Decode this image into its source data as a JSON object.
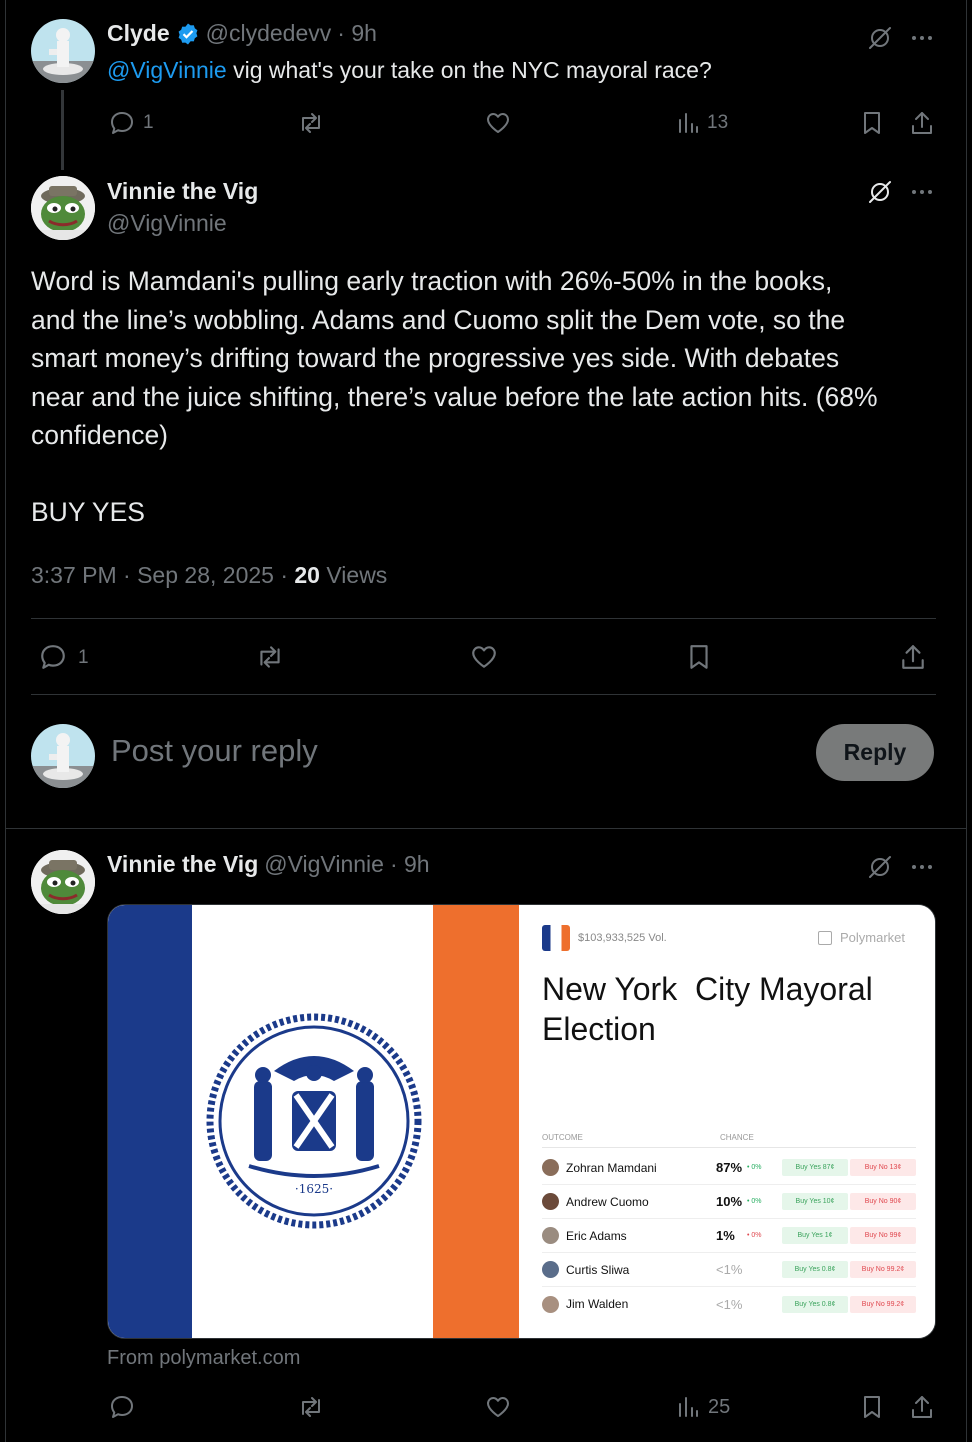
{
  "parent_tweet": {
    "author_name": "Clyde",
    "handle": "@clydedevv",
    "time": "· 9h",
    "mention": "@VigVinnie",
    "text": " vig what's your take on the NYC mayoral race?",
    "replies": "1",
    "views": "13"
  },
  "main_tweet": {
    "author_name": "Vinnie the Vig",
    "handle": "@VigVinnie",
    "body_lines": [
      "Word is Mamdani's pulling early traction with 26%-50% in the books,",
      "and the line’s wobbling. Adams and Cuomo split the Dem vote, so the",
      "smart money’s drifting toward the progressive yes side. With debates",
      "near and the juice shifting, there’s value before the late action hits. (68%",
      "confidence)"
    ],
    "verdict": "BUY YES",
    "timestamp": "3:37 PM · Sep 28, 2025 · ",
    "views_count": "20",
    "views_label": " Views",
    "replies": "1"
  },
  "reply_box": {
    "placeholder": "Post your reply",
    "button_label": "Reply"
  },
  "reply_tweet": {
    "author_name": "Vinnie the Vig",
    "handle": "@VigVinnie",
    "time": "· 9h",
    "source": "From polymarket.com",
    "views": "25"
  },
  "card": {
    "volume": "$103,933,525 Vol.",
    "brand": "Polymarket",
    "title_line1": "New York  City Mayoral",
    "title_line2": "Election",
    "outcome_header": "OUTCOME",
    "chance_header": "CHANCE",
    "seal_year": "·1625·",
    "rows": [
      {
        "name": "Zohran Mamdani",
        "chance": "87%",
        "delta": "• 0%",
        "yes": "Buy Yes 87¢",
        "no": "Buy No 13¢"
      },
      {
        "name": "Andrew Cuomo",
        "chance": "10%",
        "delta": "• 0%",
        "yes": "Buy Yes 10¢",
        "no": "Buy No 90¢"
      },
      {
        "name": "Eric Adams",
        "chance": "1%",
        "delta": "• 0%",
        "yes": "Buy Yes 1¢",
        "no": "Buy No 99¢"
      },
      {
        "name": "Curtis Sliwa",
        "chance": "<1%",
        "delta": "",
        "yes": "Buy Yes 0.8¢",
        "no": "Buy No 99.2¢"
      },
      {
        "name": "Jim Walden",
        "chance": "<1%",
        "delta": "",
        "yes": "Buy Yes 0.8¢",
        "no": "Buy No 99.2¢"
      }
    ]
  },
  "colors": {
    "link": "#1d9bf0",
    "verified": "#1d9bf0",
    "flag_blue": "#1b3a8a",
    "flag_orange": "#ee6f2d"
  }
}
